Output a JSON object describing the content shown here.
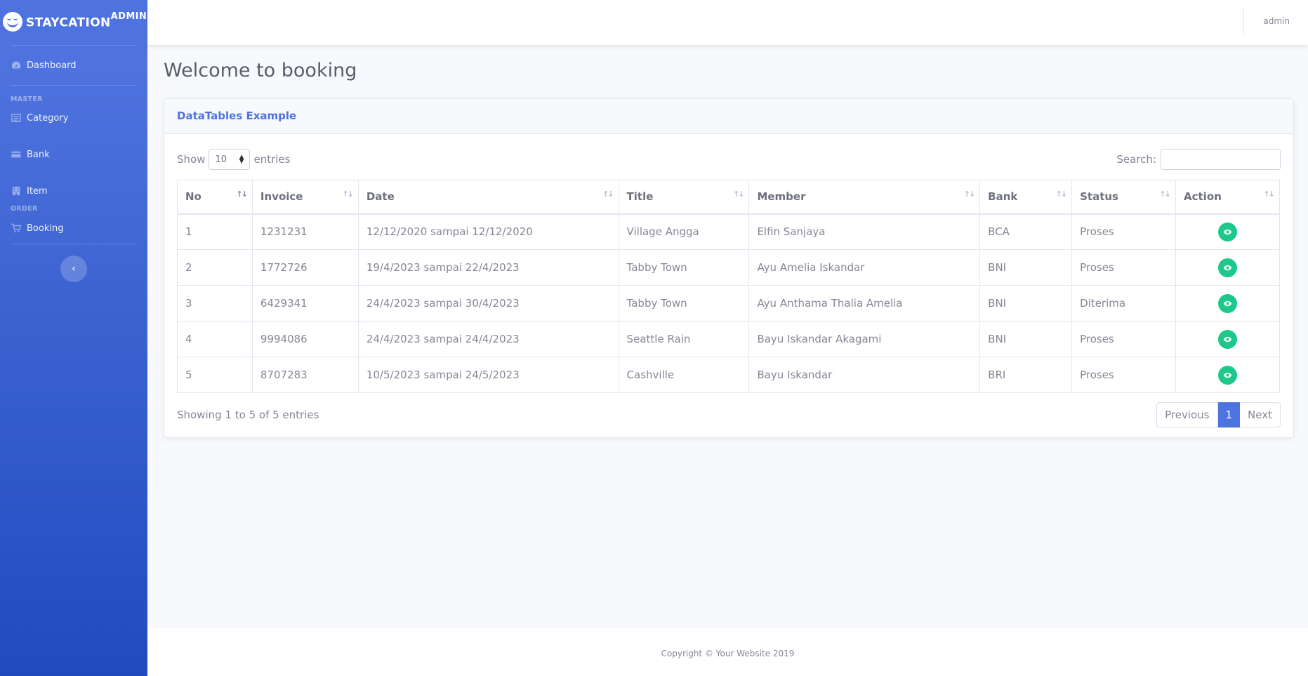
{
  "brand": {
    "name": "STAYCATION",
    "suffix": "ADMIN"
  },
  "sidebar": {
    "items": [
      {
        "label": "Dashboard",
        "icon": "tachometer-icon"
      },
      {
        "label": "Category",
        "icon": "list-icon"
      },
      {
        "label": "Bank",
        "icon": "credit-card-icon"
      },
      {
        "label": "Item",
        "icon": "building-icon"
      },
      {
        "label": "Booking",
        "icon": "cart-icon"
      }
    ],
    "headings": {
      "master": "MASTER",
      "order": "ORDER"
    },
    "toggle_glyph": "‹"
  },
  "topbar": {
    "user": "admin"
  },
  "main": {
    "title": "Welcome to booking",
    "card_title": "DataTables Example",
    "length": {
      "show": "Show",
      "value": "10",
      "entries": "entries"
    },
    "search_label": "Search:",
    "columns": [
      "No",
      "Invoice",
      "Date",
      "Title",
      "Member",
      "Bank",
      "Status",
      "Action"
    ],
    "rows": [
      {
        "no": "1",
        "invoice": "1231231",
        "date": "12/12/2020 sampai 12/12/2020",
        "title": "Village Angga",
        "member": "Elfin Sanjaya",
        "bank": "BCA",
        "status": "Proses"
      },
      {
        "no": "2",
        "invoice": "1772726",
        "date": "19/4/2023 sampai 22/4/2023",
        "title": "Tabby Town",
        "member": "Ayu Amelia Iskandar",
        "bank": "BNI",
        "status": "Proses"
      },
      {
        "no": "3",
        "invoice": "6429341",
        "date": "24/4/2023 sampai 30/4/2023",
        "title": "Tabby Town",
        "member": "Ayu Anthama Thalia Amelia",
        "bank": "BNI",
        "status": "Diterima"
      },
      {
        "no": "4",
        "invoice": "9994086",
        "date": "24/4/2023 sampai 24/4/2023",
        "title": "Seattle Rain",
        "member": "Bayu Iskandar Akagami",
        "bank": "BNI",
        "status": "Proses"
      },
      {
        "no": "5",
        "invoice": "8707283",
        "date": "10/5/2023 sampai 24/5/2023",
        "title": "Cashville",
        "member": "Bayu Iskandar",
        "bank": "BRI",
        "status": "Proses"
      }
    ],
    "info": "Showing 1 to 5 of 5 entries",
    "pagination": {
      "previous": "Previous",
      "current": "1",
      "next": "Next"
    }
  },
  "footer": {
    "copyright": "Copyright © Your Website 2019"
  },
  "colors": {
    "primary": "#4e73df",
    "success": "#1cc88a"
  }
}
